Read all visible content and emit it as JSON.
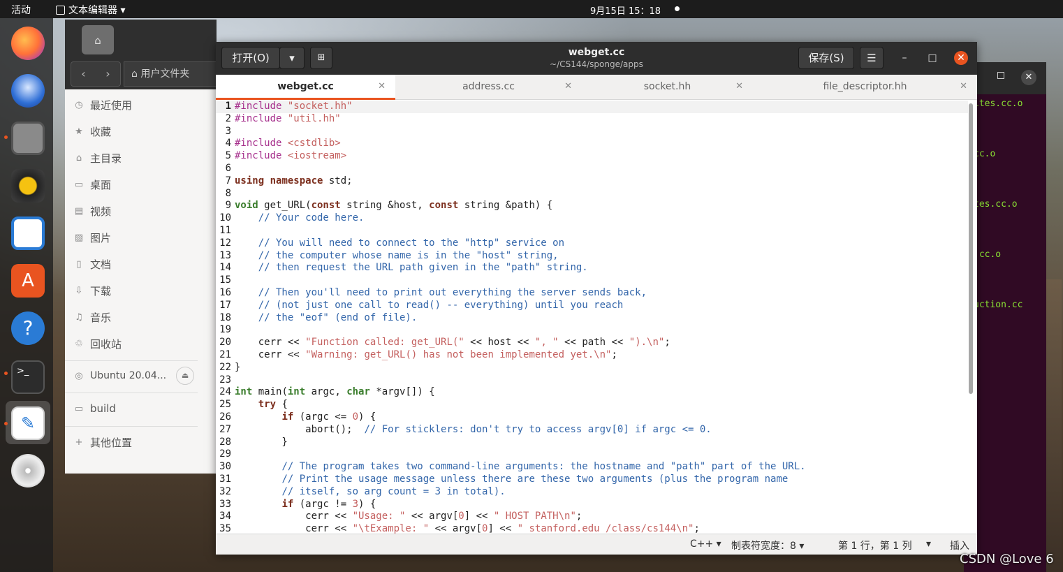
{
  "topbar": {
    "activities": "活动",
    "app_menu": "文本编辑器 ▾",
    "clock": "9月15日 15：18"
  },
  "files": {
    "crumb": "用户文件夹",
    "items": [
      "最近使用",
      "收藏",
      "主目录",
      "桌面",
      "视频",
      "图片",
      "文档",
      "下载",
      "音乐",
      "回收站"
    ],
    "drive": "Ubuntu 20.04...",
    "bookmark": "build",
    "other": "其他位置"
  },
  "terminal": {
    "lines": [
      "ites.cc.o",
      "cc.o",
      "tes.cc.o",
      ".cc.o",
      "uction.cc"
    ]
  },
  "editor": {
    "open_label": "打开(O)",
    "save_label": "保存(S)",
    "title": "webget.cc",
    "path": "~/CS144/sponge/apps",
    "tabs": [
      "webget.cc",
      "address.cc",
      "socket.hh",
      "file_descriptor.hh"
    ],
    "code_lines": [
      "#include \"socket.hh\"",
      "#include \"util.hh\"",
      "",
      "#include <cstdlib>",
      "#include <iostream>",
      "",
      "using namespace std;",
      "",
      "void get_URL(const string &host, const string &path) {",
      "    // Your code here.",
      "",
      "    // You will need to connect to the \"http\" service on",
      "    // the computer whose name is in the \"host\" string,",
      "    // then request the URL path given in the \"path\" string.",
      "",
      "    // Then you'll need to print out everything the server sends back,",
      "    // (not just one call to read() -- everything) until you reach",
      "    // the \"eof\" (end of file).",
      "",
      "    cerr << \"Function called: get_URL(\" << host << \", \" << path << \").\\n\";",
      "    cerr << \"Warning: get_URL() has not been implemented yet.\\n\";",
      "}",
      "",
      "int main(int argc, char *argv[]) {",
      "    try {",
      "        if (argc <= 0) {",
      "            abort();  // For sticklers: don't try to access argv[0] if argc <= 0.",
      "        }",
      "",
      "        // The program takes two command-line arguments: the hostname and \"path\" part of the URL.",
      "        // Print the usage message unless there are these two arguments (plus the program name",
      "        // itself, so arg count = 3 in total).",
      "        if (argc != 3) {",
      "            cerr << \"Usage: \" << argv[0] << \" HOST PATH\\n\";",
      "            cerr << \"\\tExample: \" << argv[0] << \" stanford.edu /class/cs144\\n\";"
    ],
    "status": {
      "lang": "C++ ▾",
      "tab_width": "制表符宽度：8 ▾",
      "position": "第 1 行，第 1 列",
      "mode_arrow": "▾",
      "insert": "插入"
    }
  },
  "watermark": "CSDN @Love 6"
}
